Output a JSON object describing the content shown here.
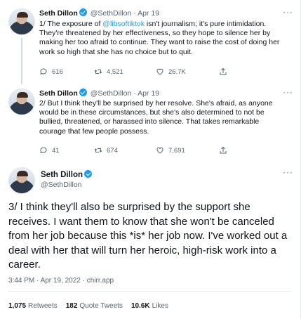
{
  "tweets": [
    {
      "name": "Seth Dillon",
      "handle": "@SethDillon",
      "sep": "·",
      "date": "Apr 19",
      "text_pre": "1/ The exposure of ",
      "mention": "@libsoftiktok",
      "text_post": " isn't journalism; it's pure intimidation. They're threatened by her effectiveness, so they hope to silence her by making her too afraid to continue. They want to raise the cost of doing her work so high that she has no choice but to quit.",
      "replies": "616",
      "retweets": "4,521",
      "likes": "26.7K"
    },
    {
      "name": "Seth Dillon",
      "handle": "@SethDillon",
      "sep": "·",
      "date": "Apr 19",
      "text": "2/ But I think they'll be surprised by her resolve. She's afraid, as anyone would be in these circumstances, but she's also determined to not be bullied, threatened, or harassed into silence. That takes remarkable courage that few people possess.",
      "replies": "41",
      "retweets": "674",
      "likes": "7,691"
    }
  ],
  "main": {
    "name": "Seth Dillon",
    "handle": "@SethDillon",
    "text": "3/ I think they'll also be surprised by the support she receives. I want them to know that she won't be canceled from her job because this *is* her job now. I've worked out a deal with her that will turn her heroic, high-risk work into a career.",
    "timestamp": "3:44 PM · Apr 19, 2022 · chirr.app",
    "stats": {
      "retweets_count": "1,075",
      "retweets_label": "Retweets",
      "quotes_count": "182",
      "quotes_label": "Quote Tweets",
      "likes_count": "10.6K",
      "likes_label": "Likes"
    }
  },
  "more_glyph": "···",
  "colors": {
    "accent": "#1d9bf0",
    "muted": "#536471",
    "text": "#0f1419"
  }
}
